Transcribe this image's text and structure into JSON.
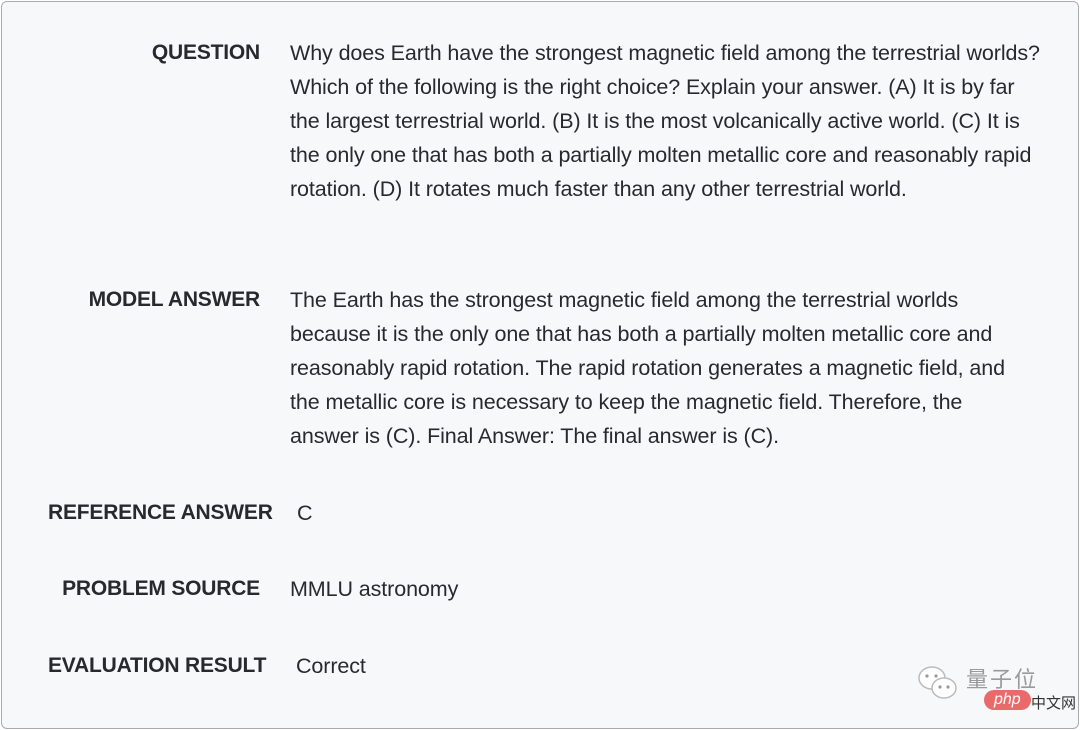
{
  "rows": [
    {
      "label": "QUESTION",
      "value": "Why does Earth have the strongest magnetic field among the terrestrial worlds? Which of the following is the right choice? Explain your answer. (A) It is by far the largest terrestrial world. (B) It is the most volcanically active world. (C) It is the only one that has both a partially molten metallic core and reasonably rapid rotation. (D) It rotates much faster than any other terrestrial world."
    },
    {
      "label": "MODEL ANSWER",
      "value": "The Earth has the strongest magnetic field among the terrestrial worlds because it is the only one that has both a partially molten metallic core and reasonably rapid rotation. The rapid rotation generates a magnetic field, and the metallic core is necessary to keep the magnetic field. Therefore, the answer is (C). Final Answer: The final answer is (C)."
    },
    {
      "label": "REFERENCE ANSWER",
      "value": "C"
    },
    {
      "label": "PROBLEM SOURCE",
      "value": "MMLU astronomy"
    },
    {
      "label": "EVALUATION RESULT",
      "value": "Correct"
    }
  ],
  "watermark": {
    "text": "量子位",
    "php": "php",
    "cn": "中文网"
  }
}
